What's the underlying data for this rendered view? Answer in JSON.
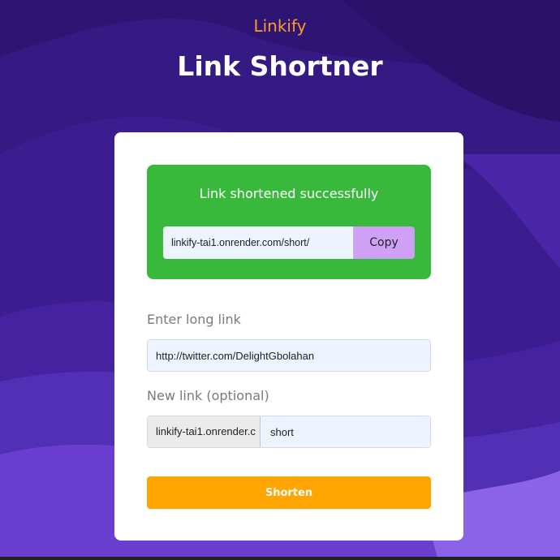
{
  "header": {
    "brand": "Linkify",
    "title": "Link Shortner"
  },
  "success": {
    "message": "Link shortened successfully",
    "short_url": "linkify-tai1.onrender.com/short/",
    "copy_label": "Copy"
  },
  "form": {
    "long_link_label": "Enter long link",
    "long_link_value": "http://twitter.com/DelightGbolahan",
    "new_link_label": "New link (optional)",
    "prefix": "linkify-tai1.onrender.c",
    "slug_value": "short",
    "submit_label": "Shorten"
  },
  "colors": {
    "background": "#3b1d8f",
    "brand": "#ff9b2e",
    "success": "#39b93b",
    "copy_button": "#cfa0f5",
    "submit_button": "#ffa400"
  }
}
